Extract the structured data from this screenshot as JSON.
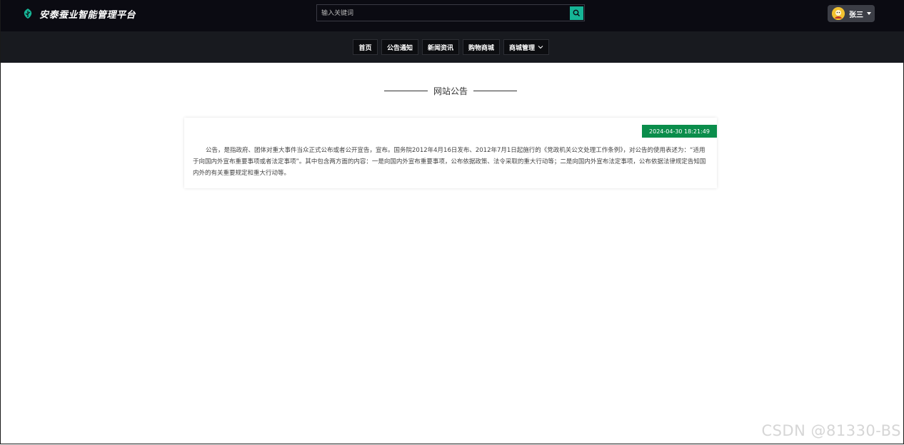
{
  "header": {
    "brand": "安泰蚕业智能管理平台",
    "logo_icon": "leaf-logo-icon",
    "search_placeholder": "输入关键词",
    "search_icon": "search-icon",
    "user_name": "张三",
    "accent_color": "#16b596"
  },
  "nav": {
    "items": [
      {
        "label": "首页"
      },
      {
        "label": "公告通知"
      },
      {
        "label": "新闻资讯"
      },
      {
        "label": "购物商城"
      },
      {
        "label": "商城管理"
      }
    ]
  },
  "main": {
    "section_title": "网站公告",
    "notice": {
      "date": "2024-04-30 18:21:49",
      "badge_color": "#0a8d4b",
      "content": "公告，是指政府、团体对重大事件当众正式公布或者公开宣告，宣布。国务院2012年4月16日发布、2012年7月1日起施行的《党政机关公文处理工作条例》，对公告的使用表述为：“适用于向国内外宣布重要事项或者法定事项”。其中包含两方面的内容：一是向国内外宣布重要事项，公布依据政策、法令采取的重大行动等；二是向国内外宣布法定事项，公布依据法律规定告知国内外的有关重要规定和重大行动等。"
    }
  },
  "watermark": "CSDN @81330-BS"
}
